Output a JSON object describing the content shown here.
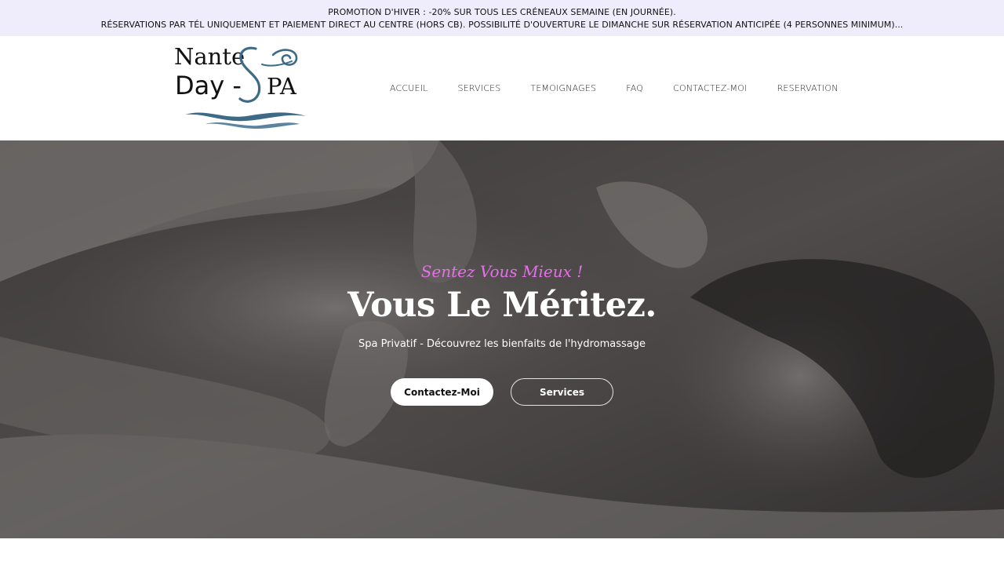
{
  "promo": {
    "line1": "PROMOTION D'HIVER : -20% SUR TOUS LES CRÉNEAUX SEMAINE (EN JOURNÉE).",
    "line2": "RÉSERVATIONS PAR TÉL UNIQUEMENT ET PAIEMENT DIRECT AU CENTRE (HORS CB). POSSIBILITÉ D'OUVERTURE LE DIMANCHE SUR RÉSERVATION ANTICIPÉE (4 PERSONNES MINIMUM)..."
  },
  "logo": {
    "word1": "Nante",
    "word2": "Day -",
    "word3": "PA",
    "letter_s": "S",
    "text_color": "#111111",
    "accent_color": "#3d6a86",
    "icon": "wave-icon"
  },
  "nav": {
    "items": [
      {
        "label": "ACCUEIL"
      },
      {
        "label": "SERVICES"
      },
      {
        "label": "TEMOIGNAGES"
      },
      {
        "label": "FAQ"
      },
      {
        "label": "CONTACTEZ-MOI"
      },
      {
        "label": "RESERVATION"
      }
    ]
  },
  "hero": {
    "tagline": "Sentez Vous Mieux !",
    "headline": "Vous Le Méritez.",
    "subtitle": "Spa Privatif - Découvrez les bienfaits de l'hydromassage",
    "primary_button": "Contactez-Moi",
    "secondary_button": "Services",
    "tagline_color": "#e76fe8",
    "image": "massage-photo"
  }
}
